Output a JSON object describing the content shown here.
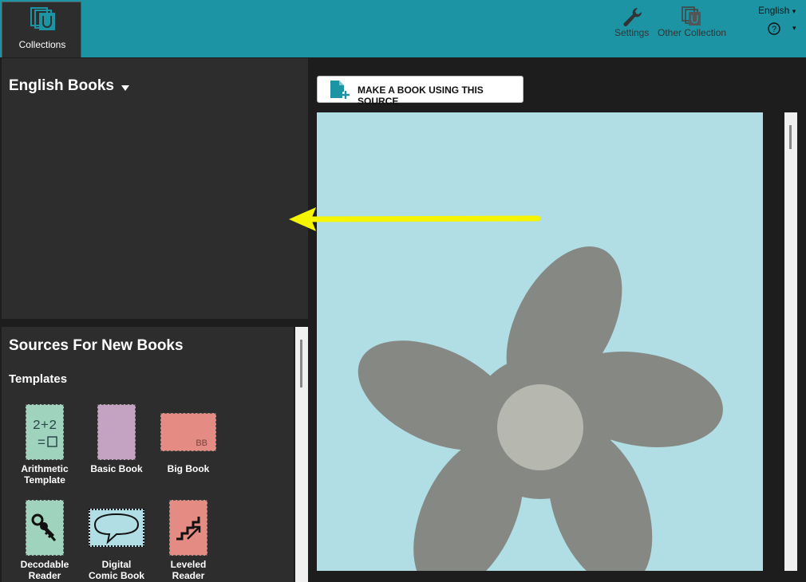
{
  "toolbar": {
    "collections_tab": "Collections",
    "settings": "Settings",
    "other_collection": "Other Collection",
    "language": "English",
    "language_caret": "▾",
    "help_caret": "▾"
  },
  "collection": {
    "title": "English Books"
  },
  "sources": {
    "title": "Sources For New Books",
    "templates_heading": "Templates",
    "templates": [
      {
        "label_line1": "Arithmetic",
        "label_line2": "Template",
        "thumb_text": "2+2\n=□",
        "color": "#9fd3bd"
      },
      {
        "label_line1": "Basic Book",
        "label_line2": "",
        "thumb_text": "",
        "color": "#c4a3c2"
      },
      {
        "label_line1": "Big Book",
        "label_line2": "",
        "thumb_text": "BB",
        "color": "#e48c84"
      },
      {
        "label_line1": "Decodable",
        "label_line2": "Reader",
        "thumb_text": "",
        "color": "#9fd3bd"
      },
      {
        "label_line1": "Digital",
        "label_line2": "Comic Book",
        "thumb_text": "",
        "color": "#b1dde4"
      },
      {
        "label_line1": "Leveled",
        "label_line2": "Reader",
        "thumb_text": "",
        "color": "#e48c84"
      }
    ]
  },
  "preview": {
    "make_book_button": "MAKE A BOOK USING THIS SOURCE"
  },
  "colors": {
    "accent": "#1d94a4",
    "arrow": "#f5f500",
    "flower": "#868884",
    "page_bg": "#b1dde4"
  }
}
